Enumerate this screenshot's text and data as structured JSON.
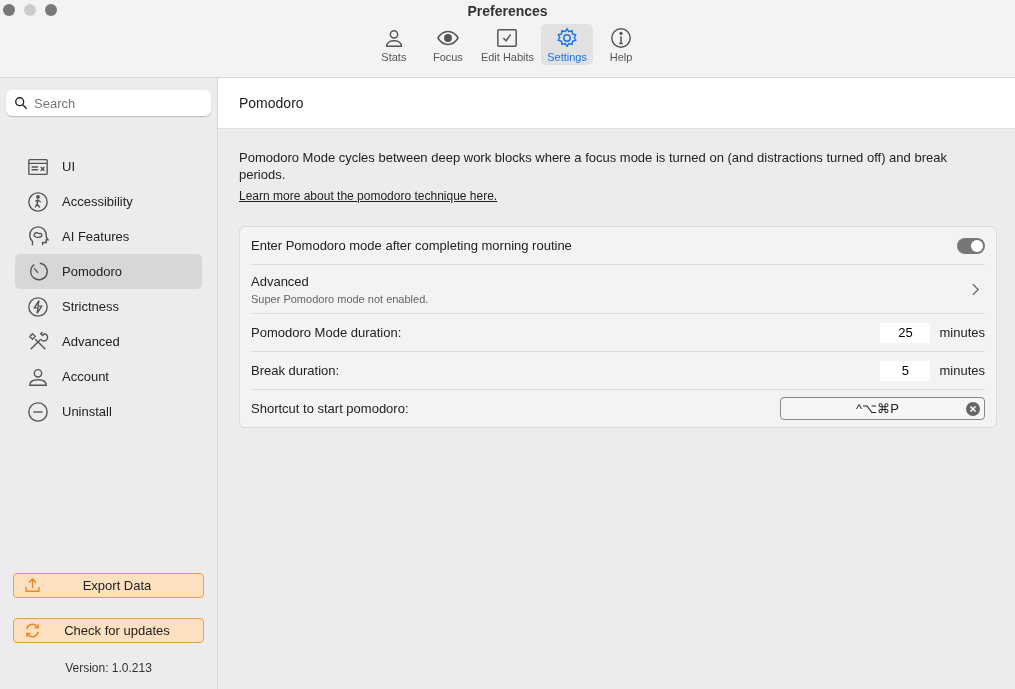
{
  "window": {
    "title": "Preferences"
  },
  "toolbar": [
    {
      "label": "Stats",
      "selected": false
    },
    {
      "label": "Focus",
      "selected": false
    },
    {
      "label": "Edit Habits",
      "selected": false
    },
    {
      "label": "Settings",
      "selected": true
    },
    {
      "label": "Help",
      "selected": false
    }
  ],
  "sidebar": {
    "search": {
      "placeholder": "Search"
    },
    "items": [
      {
        "label": "UI",
        "selected": false
      },
      {
        "label": "Accessibility",
        "selected": false
      },
      {
        "label": "AI Features",
        "selected": false
      },
      {
        "label": "Pomodoro",
        "selected": true
      },
      {
        "label": "Strictness",
        "selected": false
      },
      {
        "label": "Advanced",
        "selected": false
      },
      {
        "label": "Account",
        "selected": false
      },
      {
        "label": "Uninstall",
        "selected": false
      }
    ],
    "buttons": [
      {
        "label": "Export Data"
      },
      {
        "label": "Check for updates"
      }
    ],
    "version": "Version: 1.0.213"
  },
  "content": {
    "title": "Pomodoro",
    "description": "Pomodoro Mode cycles between deep work blocks where a focus mode is turned on (and distractions turned off) and break periods.",
    "link": "Learn more about the pomodoro technique here.",
    "settings": [
      {
        "kind": "toggle",
        "label": "Enter Pomodoro mode after completing morning routine",
        "on": true
      },
      {
        "kind": "nav",
        "label": "Advanced",
        "subtitle": "Super Pomodoro mode not enabled."
      },
      {
        "kind": "number",
        "label": "Pomodoro Mode duration:",
        "value": "25",
        "unit": "minutes"
      },
      {
        "kind": "number",
        "label": "Break duration:",
        "value": "5",
        "unit": "minutes"
      },
      {
        "kind": "shortcut",
        "label": "Shortcut to start pomodoro:",
        "value": "^⌥⌘P"
      }
    ]
  }
}
